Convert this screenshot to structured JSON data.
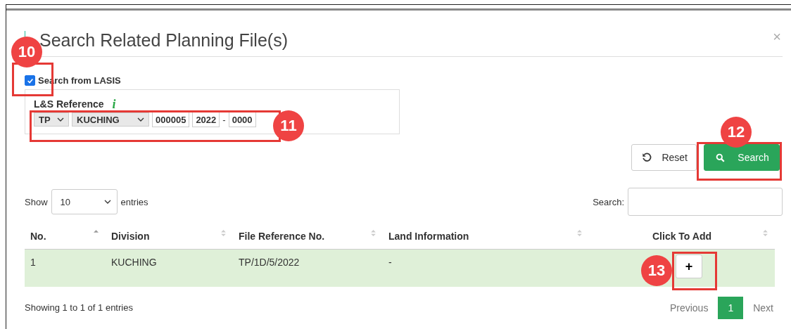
{
  "dialog": {
    "title": "Search Related Planning File(s)",
    "close": "×"
  },
  "lasis": {
    "label": "Search from LASIS",
    "checked": true
  },
  "reference": {
    "label": "L&S Reference",
    "info": "i",
    "prefix": "TP",
    "division": "KUCHING",
    "number": "000005",
    "year": "2022",
    "separator": "-",
    "suffix": "0000"
  },
  "buttons": [
    {
      "kind": "reset",
      "label": "Reset"
    },
    {
      "kind": "search",
      "label": "Search"
    }
  ],
  "length": {
    "show": "Show",
    "value": "10",
    "entries": "entries"
  },
  "filter": {
    "label": "Search:"
  },
  "table": {
    "columns": [
      "No.",
      "Division",
      "File Reference No.",
      "Land Information",
      "Click To Add"
    ],
    "rows": [
      {
        "cells": [
          "1",
          "KUCHING",
          "TP/1D/5/2022",
          "-"
        ],
        "add": "+"
      }
    ]
  },
  "info": "Showing 1 to 1 of 1 entries",
  "pagination": [
    {
      "label": "Previous",
      "selected": false
    },
    {
      "label": "1",
      "selected": true
    },
    {
      "label": "Next",
      "selected": false
    }
  ],
  "annotations": [
    {
      "label": "10"
    },
    {
      "label": "11"
    },
    {
      "label": "12"
    },
    {
      "label": "13"
    }
  ]
}
